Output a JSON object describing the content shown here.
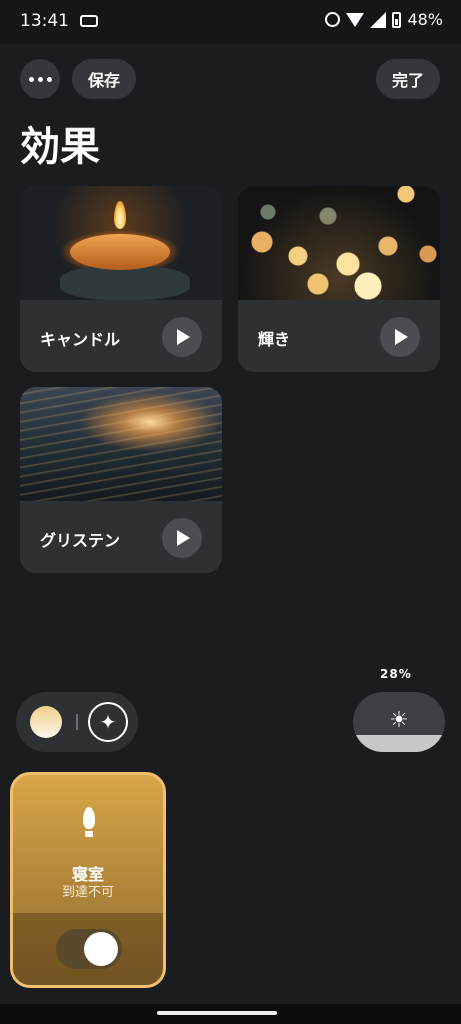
{
  "status_bar": {
    "time": "13:41",
    "battery": "48%"
  },
  "toolbar": {
    "save_label": "保存",
    "done_label": "完了"
  },
  "page_title": "効果",
  "effects": [
    {
      "label": "キャンドル"
    },
    {
      "label": "輝き"
    },
    {
      "label": "グリステン"
    }
  ],
  "brightness": {
    "label": "28%",
    "level": 0.28
  },
  "device": {
    "name": "寝室",
    "status": "到達不可",
    "on": false
  },
  "icons": {
    "more": "more-icon",
    "play": "play-icon",
    "sparkle": "sparkle-icon",
    "sun": "sun-icon",
    "bulb": "bulb-icon"
  },
  "colors": {
    "accent": "#f0c06e",
    "background": "#1a1c1f",
    "card": "#2e3134"
  }
}
